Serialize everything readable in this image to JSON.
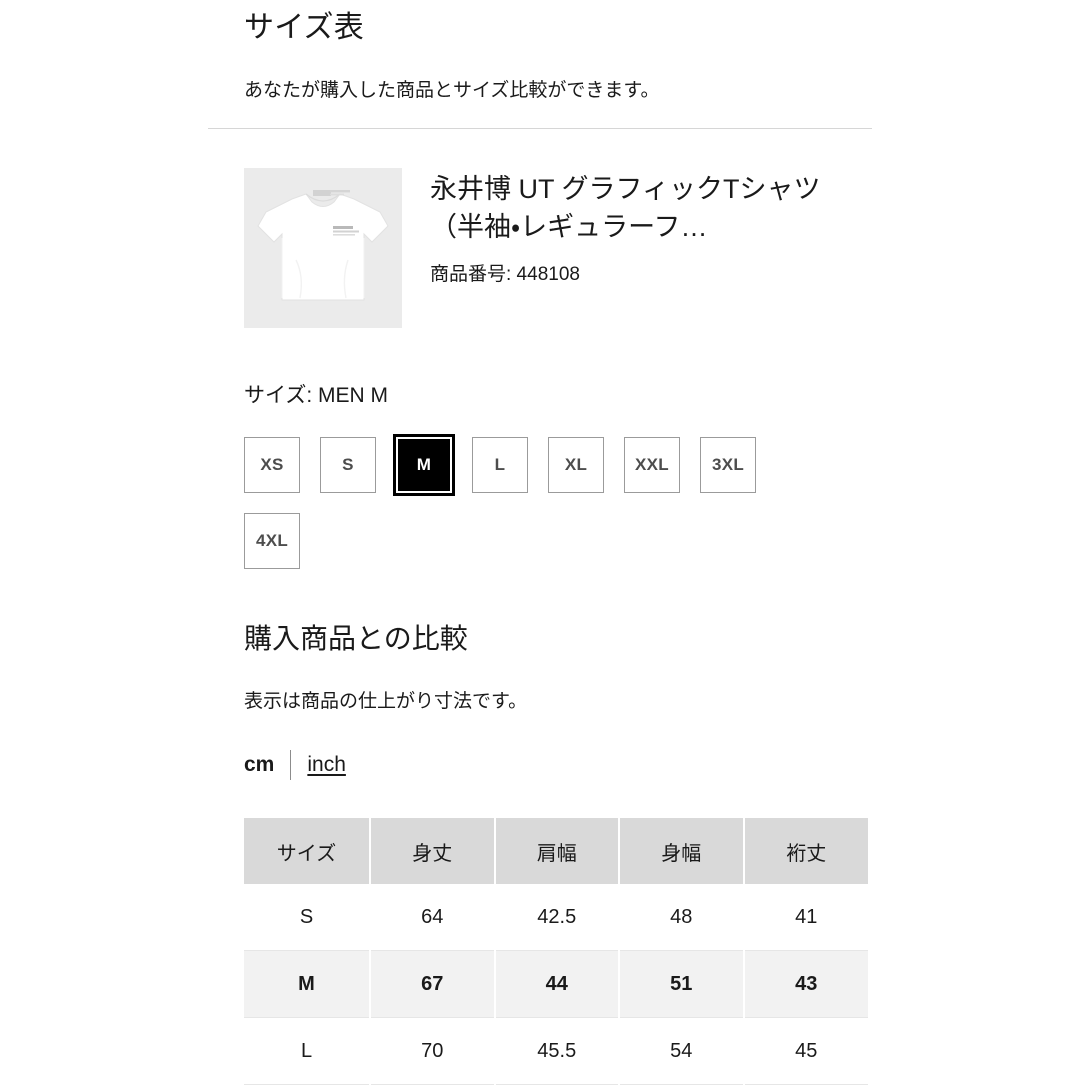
{
  "header": {
    "title": "サイズ表",
    "subtitle": "あなたが購入した商品とサイズ比較ができます。"
  },
  "product": {
    "name": "永井博 UT グラフィックTシャツ（半袖・レギュラーフ…",
    "code_label": "商品番号: 448108",
    "thumb_alt": "tshirt-thumbnail",
    "thumb_bg": "#ebebeb"
  },
  "size_selector": {
    "current_label": "サイズ: MEN M",
    "selected": "M",
    "chips": [
      {
        "label": "XS",
        "selected": false
      },
      {
        "label": "S",
        "selected": false
      },
      {
        "label": "M",
        "selected": true
      },
      {
        "label": "L",
        "selected": false
      },
      {
        "label": "XL",
        "selected": false
      },
      {
        "label": "XXL",
        "selected": false
      },
      {
        "label": "3XL",
        "selected": false
      },
      {
        "label": "4XL",
        "selected": false
      }
    ]
  },
  "comparison": {
    "title": "購入商品との比較",
    "note": "表示は商品の仕上がり寸法です。",
    "unit_active": "cm",
    "unit_link": "inch"
  },
  "size_table": {
    "columns": [
      "サイズ",
      "身丈",
      "肩幅",
      "身幅",
      "裄丈"
    ],
    "rows": [
      {
        "size": "S",
        "values": [
          "64",
          "42.5",
          "48",
          "41"
        ],
        "highlight": false
      },
      {
        "size": "M",
        "values": [
          "67",
          "44",
          "51",
          "43"
        ],
        "highlight": true
      },
      {
        "size": "L",
        "values": [
          "70",
          "45.5",
          "54",
          "45"
        ],
        "highlight": false
      }
    ]
  },
  "colors": {
    "text": "#1a1a1a",
    "chip_border": "#9b9b9b",
    "chip_selected_bg": "#000000",
    "table_header_bg": "#d9d9d9",
    "table_highlight_bg": "#f2f2f2",
    "divider": "#d6d6d6"
  }
}
